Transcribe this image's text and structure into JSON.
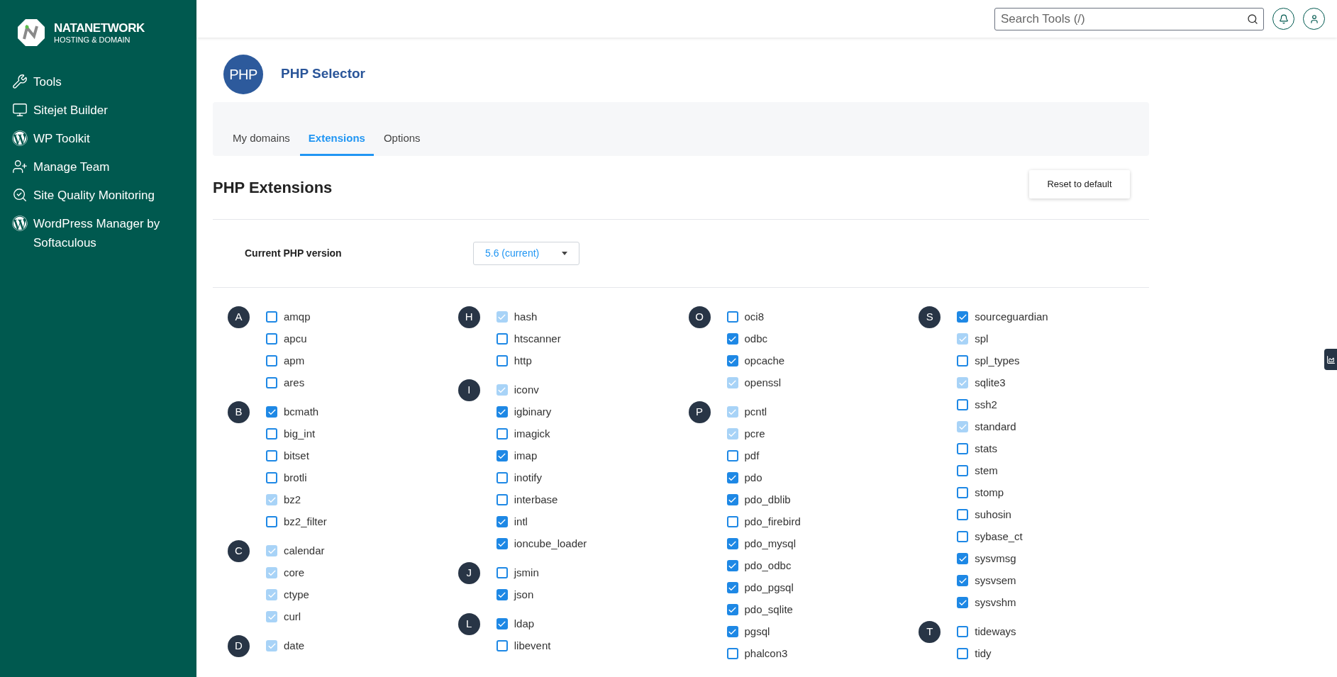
{
  "brand": {
    "name": "NATANETWORK",
    "tagline": "HOSTING & DOMAIN"
  },
  "sidebar": {
    "items": [
      {
        "label": "Tools",
        "kind": "tools"
      },
      {
        "label": "Sitejet Builder",
        "kind": "monitor"
      },
      {
        "label": "WP Toolkit",
        "kind": "wordpress"
      },
      {
        "label": "Manage Team",
        "kind": "team"
      },
      {
        "label": "Site Quality Monitoring",
        "kind": "search"
      },
      {
        "label": "WordPress Manager by Softaculous",
        "kind": "wordpress"
      }
    ]
  },
  "header": {
    "search": {
      "placeholder": "Search Tools (/)"
    }
  },
  "page": {
    "logo_text": "PHP",
    "title": "PHP Selector"
  },
  "tabs": [
    {
      "label": "My domains",
      "selected": false
    },
    {
      "label": "Extensions",
      "selected": true
    },
    {
      "label": "Options",
      "selected": false
    }
  ],
  "section": {
    "title": "PHP Extensions",
    "reset_button": "Reset to default",
    "version_label": "Current PHP version",
    "version_value": "5.6 (current)"
  },
  "columns": [
    {
      "groups": [
        {
          "letter": "A",
          "items": [
            {
              "name": "amqp",
              "checked": false,
              "disabled": false
            },
            {
              "name": "apcu",
              "checked": false,
              "disabled": false
            },
            {
              "name": "apm",
              "checked": false,
              "disabled": false
            },
            {
              "name": "ares",
              "checked": false,
              "disabled": false
            }
          ]
        },
        {
          "letter": "B",
          "items": [
            {
              "name": "bcmath",
              "checked": true,
              "disabled": false
            },
            {
              "name": "big_int",
              "checked": false,
              "disabled": false
            },
            {
              "name": "bitset",
              "checked": false,
              "disabled": false
            },
            {
              "name": "brotli",
              "checked": false,
              "disabled": false
            },
            {
              "name": "bz2",
              "checked": true,
              "disabled": true
            },
            {
              "name": "bz2_filter",
              "checked": false,
              "disabled": false
            }
          ]
        },
        {
          "letter": "C",
          "items": [
            {
              "name": "calendar",
              "checked": true,
              "disabled": true
            },
            {
              "name": "core",
              "checked": true,
              "disabled": true
            },
            {
              "name": "ctype",
              "checked": true,
              "disabled": true
            },
            {
              "name": "curl",
              "checked": true,
              "disabled": true
            }
          ]
        },
        {
          "letter": "D",
          "items": [
            {
              "name": "date",
              "checked": true,
              "disabled": true
            }
          ]
        }
      ]
    },
    {
      "groups": [
        {
          "letter": "H",
          "items": [
            {
              "name": "hash",
              "checked": true,
              "disabled": true
            },
            {
              "name": "htscanner",
              "checked": false,
              "disabled": false
            },
            {
              "name": "http",
              "checked": false,
              "disabled": false
            }
          ]
        },
        {
          "letter": "I",
          "items": [
            {
              "name": "iconv",
              "checked": true,
              "disabled": true
            },
            {
              "name": "igbinary",
              "checked": true,
              "disabled": false
            },
            {
              "name": "imagick",
              "checked": false,
              "disabled": false
            },
            {
              "name": "imap",
              "checked": true,
              "disabled": false
            },
            {
              "name": "inotify",
              "checked": false,
              "disabled": false
            },
            {
              "name": "interbase",
              "checked": false,
              "disabled": false
            },
            {
              "name": "intl",
              "checked": true,
              "disabled": false
            },
            {
              "name": "ioncube_loader",
              "checked": true,
              "disabled": false
            }
          ]
        },
        {
          "letter": "J",
          "items": [
            {
              "name": "jsmin",
              "checked": false,
              "disabled": false
            },
            {
              "name": "json",
              "checked": true,
              "disabled": false
            }
          ]
        },
        {
          "letter": "L",
          "items": [
            {
              "name": "ldap",
              "checked": true,
              "disabled": false
            },
            {
              "name": "libevent",
              "checked": false,
              "disabled": false
            }
          ]
        }
      ]
    },
    {
      "groups": [
        {
          "letter": "O",
          "items": [
            {
              "name": "oci8",
              "checked": false,
              "disabled": false
            },
            {
              "name": "odbc",
              "checked": true,
              "disabled": false
            },
            {
              "name": "opcache",
              "checked": true,
              "disabled": false
            },
            {
              "name": "openssl",
              "checked": true,
              "disabled": true
            }
          ]
        },
        {
          "letter": "P",
          "items": [
            {
              "name": "pcntl",
              "checked": true,
              "disabled": true
            },
            {
              "name": "pcre",
              "checked": true,
              "disabled": true
            },
            {
              "name": "pdf",
              "checked": false,
              "disabled": false
            },
            {
              "name": "pdo",
              "checked": true,
              "disabled": false
            },
            {
              "name": "pdo_dblib",
              "checked": true,
              "disabled": false
            },
            {
              "name": "pdo_firebird",
              "checked": false,
              "disabled": false
            },
            {
              "name": "pdo_mysql",
              "checked": true,
              "disabled": false
            },
            {
              "name": "pdo_odbc",
              "checked": true,
              "disabled": false
            },
            {
              "name": "pdo_pgsql",
              "checked": true,
              "disabled": false
            },
            {
              "name": "pdo_sqlite",
              "checked": true,
              "disabled": false
            },
            {
              "name": "pgsql",
              "checked": true,
              "disabled": false
            },
            {
              "name": "phalcon3",
              "checked": false,
              "disabled": false
            }
          ]
        }
      ]
    },
    {
      "groups": [
        {
          "letter": "S",
          "items": [
            {
              "name": "sourceguardian",
              "checked": true,
              "disabled": false
            },
            {
              "name": "spl",
              "checked": true,
              "disabled": true
            },
            {
              "name": "spl_types",
              "checked": false,
              "disabled": false
            },
            {
              "name": "sqlite3",
              "checked": true,
              "disabled": true
            },
            {
              "name": "ssh2",
              "checked": false,
              "disabled": false
            },
            {
              "name": "standard",
              "checked": true,
              "disabled": true
            },
            {
              "name": "stats",
              "checked": false,
              "disabled": false
            },
            {
              "name": "stem",
              "checked": false,
              "disabled": false
            },
            {
              "name": "stomp",
              "checked": false,
              "disabled": false
            },
            {
              "name": "suhosin",
              "checked": false,
              "disabled": false
            },
            {
              "name": "sybase_ct",
              "checked": false,
              "disabled": false
            },
            {
              "name": "sysvmsg",
              "checked": true,
              "disabled": false
            },
            {
              "name": "sysvsem",
              "checked": true,
              "disabled": false
            },
            {
              "name": "sysvshm",
              "checked": true,
              "disabled": false
            }
          ]
        },
        {
          "letter": "T",
          "items": [
            {
              "name": "tideways",
              "checked": false,
              "disabled": false
            },
            {
              "name": "tidy",
              "checked": false,
              "disabled": false
            }
          ]
        }
      ]
    }
  ]
}
